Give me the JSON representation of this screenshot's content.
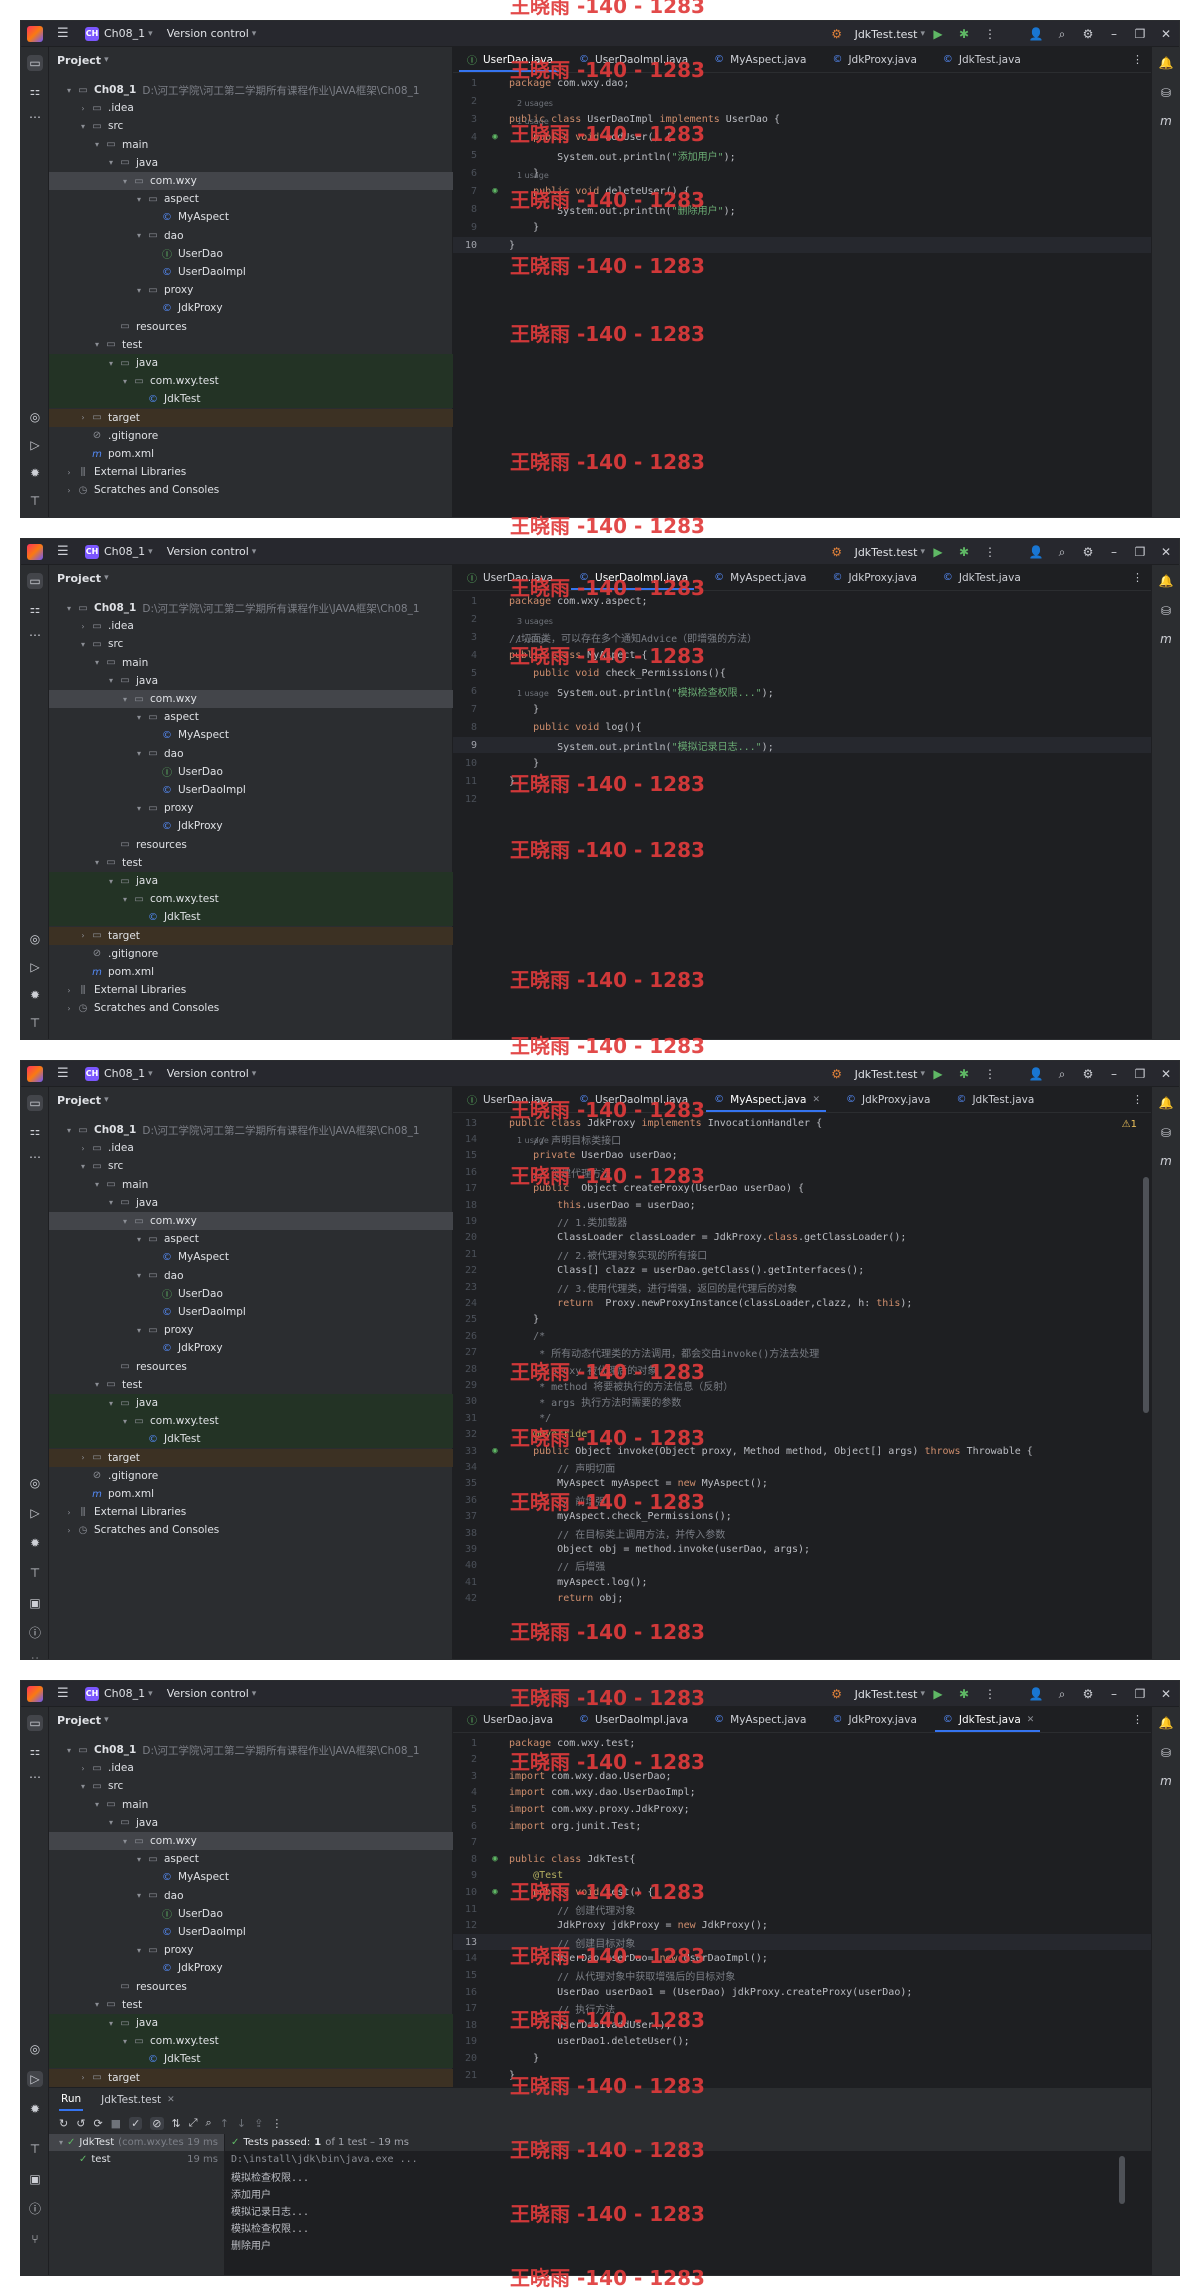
{
  "watermark": "王晓雨 -140 - 1283",
  "ide": {
    "project_name": "Ch08_1",
    "project_badge": "CH",
    "vcs_label": "Version control",
    "run_config": "JdkTest.test",
    "project_panel_title": "Project",
    "project_root": "Ch08_1",
    "project_path": "D:\\河工学院\\河工第二学期所有课程作业\\JAVA框架\\Ch08_1",
    "tabs": [
      "UserDao.java",
      "UserDaoImpl.java",
      "MyAspect.java",
      "JdkProxy.java",
      "JdkTest.java"
    ],
    "tree": [
      ".idea",
      "src",
      "main",
      "java",
      "com.wxy",
      "aspect",
      "MyAspect",
      "dao",
      "UserDao",
      "UserDaoImpl",
      "proxy",
      "JdkProxy",
      "resources",
      "test",
      "java",
      "com.wxy.test",
      "JdkTest",
      "target",
      ".gitignore",
      "pom.xml",
      "External Libraries",
      "Scratches and Consoles"
    ]
  },
  "panel1": {
    "lines": [
      {
        "n": "1",
        "t": "package com.wxy.dao;"
      },
      {
        "n": "2",
        "t": ""
      },
      {
        "n": "3",
        "t": "public class UserDaoImpl implements UserDao {"
      },
      {
        "n": "4",
        "t": "    public void addUser() {"
      },
      {
        "n": "5",
        "t": "        System.out.println(\"添加用户\");"
      },
      {
        "n": "6",
        "t": "    }"
      },
      {
        "n": "7",
        "t": "    public void deleteUser() {"
      },
      {
        "n": "8",
        "t": "        System.out.println(\"删除用户\");"
      },
      {
        "n": "9",
        "t": "    }"
      },
      {
        "n": "10",
        "t": "}"
      }
    ],
    "hints": [
      "2 usages",
      "1 usage",
      "1 usage"
    ]
  },
  "panel2": {
    "lines": [
      {
        "n": "1",
        "t": "package com.wxy.aspect;"
      },
      {
        "n": "2",
        "t": ""
      },
      {
        "n": "3",
        "t": "//切面类，可以存在多个通知Advice（即增强的方法）"
      },
      {
        "n": "4",
        "t": "public class MyAspect {"
      },
      {
        "n": "5",
        "t": "    public void check_Permissions(){"
      },
      {
        "n": "6",
        "t": "        System.out.println(\"模拟检查权限...\");"
      },
      {
        "n": "7",
        "t": "    }"
      },
      {
        "n": "8",
        "t": "    public void log(){"
      },
      {
        "n": "9",
        "t": "        System.out.println(\"模拟记录日志...\");"
      },
      {
        "n": "10",
        "t": "    }"
      },
      {
        "n": "11",
        "t": "}"
      },
      {
        "n": "12",
        "t": ""
      }
    ],
    "hints": [
      "3 usages",
      "1 usage",
      "1 usage"
    ]
  },
  "panel3": {
    "warning": "⚠1",
    "lines": [
      {
        "n": "13",
        "t": "public class JdkProxy implements InvocationHandler {"
      },
      {
        "n": "14",
        "t": "    // 声明目标类接口"
      },
      {
        "n": "15",
        "t": "    private UserDao userDao;"
      },
      {
        "n": "16",
        "t": "    // 创建代理方法"
      },
      {
        "n": "17",
        "t": "    public  Object createProxy(UserDao userDao) {"
      },
      {
        "n": "18",
        "t": "        this.userDao = userDao;"
      },
      {
        "n": "19",
        "t": "        // 1.类加载器"
      },
      {
        "n": "20",
        "t": "        ClassLoader classLoader = JdkProxy.class.getClassLoader();"
      },
      {
        "n": "21",
        "t": "        // 2.被代理对象实现的所有接口"
      },
      {
        "n": "22",
        "t": "        Class[] clazz = userDao.getClass().getInterfaces();"
      },
      {
        "n": "23",
        "t": "        // 3.使用代理类，进行增强，返回的是代理后的对象"
      },
      {
        "n": "24",
        "t": "        return  Proxy.newProxyInstance(classLoader,clazz, h: this);"
      },
      {
        "n": "25",
        "t": "    }"
      },
      {
        "n": "26",
        "t": "    /*"
      },
      {
        "n": "27",
        "t": "     * 所有动态代理类的方法调用，都会交由invoke()方法去处理"
      },
      {
        "n": "28",
        "t": "     * proxy 被代理后的对象"
      },
      {
        "n": "29",
        "t": "     * method 将要被执行的方法信息（反射）"
      },
      {
        "n": "30",
        "t": "     * args 执行方法时需要的参数"
      },
      {
        "n": "31",
        "t": "     */"
      },
      {
        "n": "32",
        "t": "    @Override"
      },
      {
        "n": "33",
        "t": "    public Object invoke(Object proxy, Method method, Object[] args) throws Throwable {"
      },
      {
        "n": "34",
        "t": "        // 声明切面"
      },
      {
        "n": "35",
        "t": "        MyAspect myAspect = new MyAspect();"
      },
      {
        "n": "36",
        "t": "        // 前增强"
      },
      {
        "n": "37",
        "t": "        myAspect.check_Permissions();"
      },
      {
        "n": "38",
        "t": "        // 在目标类上调用方法，并传入参数"
      },
      {
        "n": "39",
        "t": "        Object obj = method.invoke(userDao, args);"
      },
      {
        "n": "40",
        "t": "        // 后增强"
      },
      {
        "n": "41",
        "t": "        myAspect.log();"
      },
      {
        "n": "42",
        "t": "        return obj;"
      }
    ],
    "hints": [
      "1 usage"
    ]
  },
  "panel4": {
    "lines": [
      {
        "n": "1",
        "t": "package com.wxy.test;"
      },
      {
        "n": "2",
        "t": ""
      },
      {
        "n": "3",
        "t": "import com.wxy.dao.UserDao;"
      },
      {
        "n": "4",
        "t": "import com.wxy.dao.UserDaoImpl;"
      },
      {
        "n": "5",
        "t": "import com.wxy.proxy.JdkProxy;"
      },
      {
        "n": "6",
        "t": "import org.junit.Test;"
      },
      {
        "n": "7",
        "t": ""
      },
      {
        "n": "8",
        "t": "public class JdkTest{"
      },
      {
        "n": "9",
        "t": "    @Test"
      },
      {
        "n": "10",
        "t": "    public void test() {"
      },
      {
        "n": "11",
        "t": "        // 创建代理对象"
      },
      {
        "n": "12",
        "t": "        JdkProxy jdkProxy = new JdkProxy();"
      },
      {
        "n": "13",
        "t": "        // 创建目标对象"
      },
      {
        "n": "14",
        "t": "        UserDao userDao= new UserDaoImpl();"
      },
      {
        "n": "15",
        "t": "        // 从代理对象中获取增强后的目标对象"
      },
      {
        "n": "16",
        "t": "        UserDao userDao1 = (UserDao) jdkProxy.createProxy(userDao);"
      },
      {
        "n": "17",
        "t": "        // 执行方法"
      },
      {
        "n": "18",
        "t": "        userDao1.addUser();"
      },
      {
        "n": "19",
        "t": "        userDao1.deleteUser();"
      },
      {
        "n": "20",
        "t": "    }"
      },
      {
        "n": "21",
        "t": "}"
      }
    ],
    "run": {
      "tab_run": "Run",
      "tab_config": "JdkTest.test",
      "tests_passed_label": "Tests passed:",
      "tests_passed_count": "1",
      "tests_passed_rest": "of 1 test – 19 ms",
      "tree_root": "JdkTest",
      "tree_root_pkg": "(com.wxy.tes",
      "tree_root_time": "19 ms",
      "tree_child": "test",
      "tree_child_time": "19 ms",
      "console": [
        "D:\\install\\jdk\\bin\\java.exe ...",
        "模拟检查权限...",
        "添加用户",
        "模拟记录日志...",
        "模拟检查权限...",
        "删除用户"
      ]
    }
  }
}
